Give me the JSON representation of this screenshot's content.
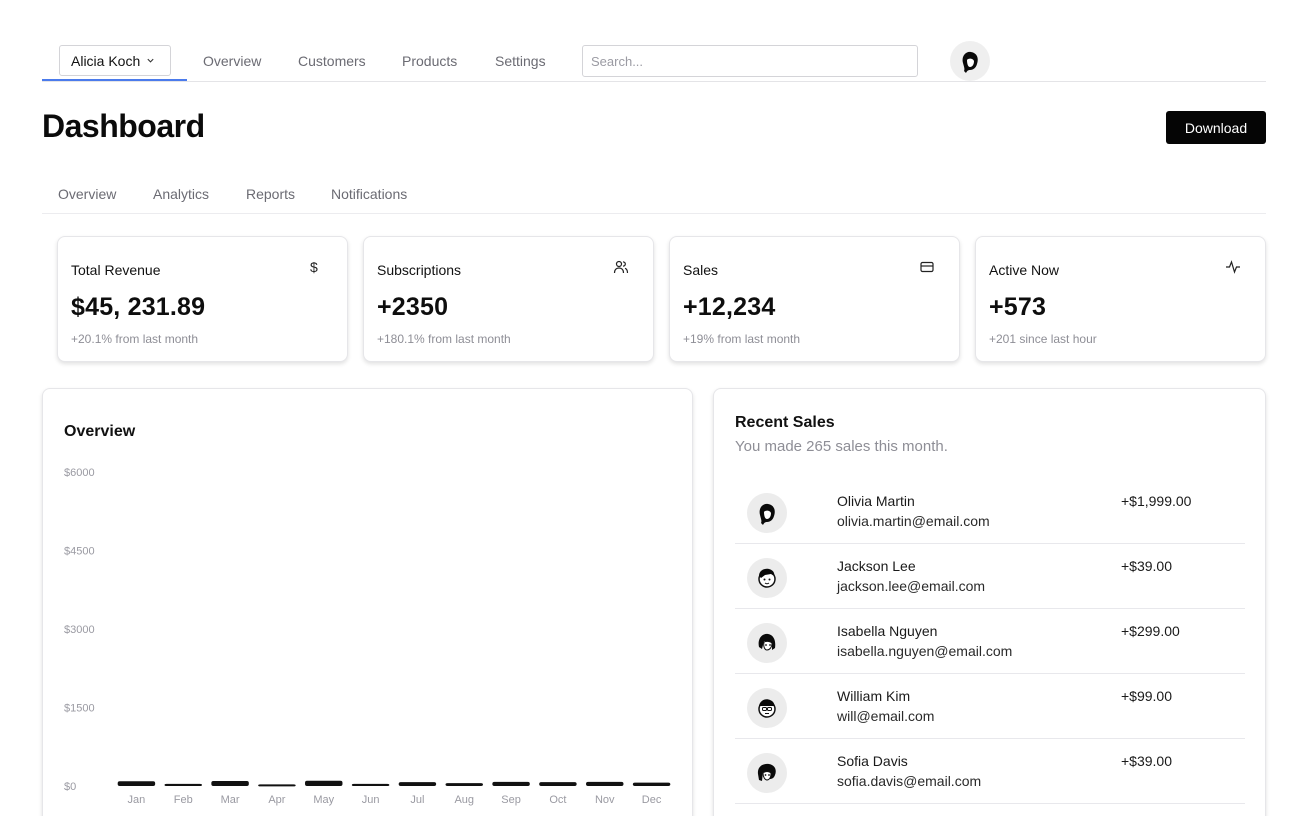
{
  "topnav": {
    "team": "Alicia Koch",
    "links": [
      "Overview",
      "Customers",
      "Products",
      "Settings"
    ],
    "search_placeholder": "Search..."
  },
  "header": {
    "title": "Dashboard",
    "download_label": "Download"
  },
  "tabs": [
    "Overview",
    "Analytics",
    "Reports",
    "Notifications"
  ],
  "stats": [
    {
      "label": "Total Revenue",
      "value": "$45, 231.89",
      "sub": "+20.1% from last month",
      "icon": "dollar-icon"
    },
    {
      "label": "Subscriptions",
      "value": "+2350",
      "sub": "+180.1% from last month",
      "icon": "users-icon"
    },
    {
      "label": "Sales",
      "value": "+12,234",
      "sub": "+19% from last month",
      "icon": "credit-card-icon"
    },
    {
      "label": "Active Now",
      "value": "+573",
      "sub": "+201 since last hour",
      "icon": "activity-icon"
    }
  ],
  "overview": {
    "title": "Overview"
  },
  "chart_data": {
    "type": "bar",
    "title": "Overview",
    "categories": [
      "Jan",
      "Feb",
      "Mar",
      "Apr",
      "May",
      "Jun",
      "Jul",
      "Aug",
      "Sep",
      "Oct",
      "Nov",
      "Dec"
    ],
    "values": [
      90,
      40,
      95,
      30,
      100,
      40,
      75,
      55,
      80,
      75,
      80,
      65
    ],
    "yticks": [
      "$6000",
      "$4500",
      "$3000",
      "$1500",
      "$0"
    ],
    "ylim": [
      0,
      6000
    ],
    "grid": false,
    "legend": "none"
  },
  "recent_sales": {
    "title": "Recent Sales",
    "subtitle": "You made 265 sales this month.",
    "items": [
      {
        "name": "Olivia Martin",
        "email": "olivia.martin@email.com",
        "amount": "+$1,999.00"
      },
      {
        "name": "Jackson Lee",
        "email": "jackson.lee@email.com",
        "amount": "+$39.00"
      },
      {
        "name": "Isabella Nguyen",
        "email": "isabella.nguyen@email.com",
        "amount": "+$299.00"
      },
      {
        "name": "William Kim",
        "email": "will@email.com",
        "amount": "+$99.00"
      },
      {
        "name": "Sofia Davis",
        "email": "sofia.davis@email.com",
        "amount": "+$39.00"
      }
    ]
  },
  "colors": {
    "accent_underline": "#4b7bec",
    "bar": "#111111",
    "primary_button": "#050505"
  }
}
